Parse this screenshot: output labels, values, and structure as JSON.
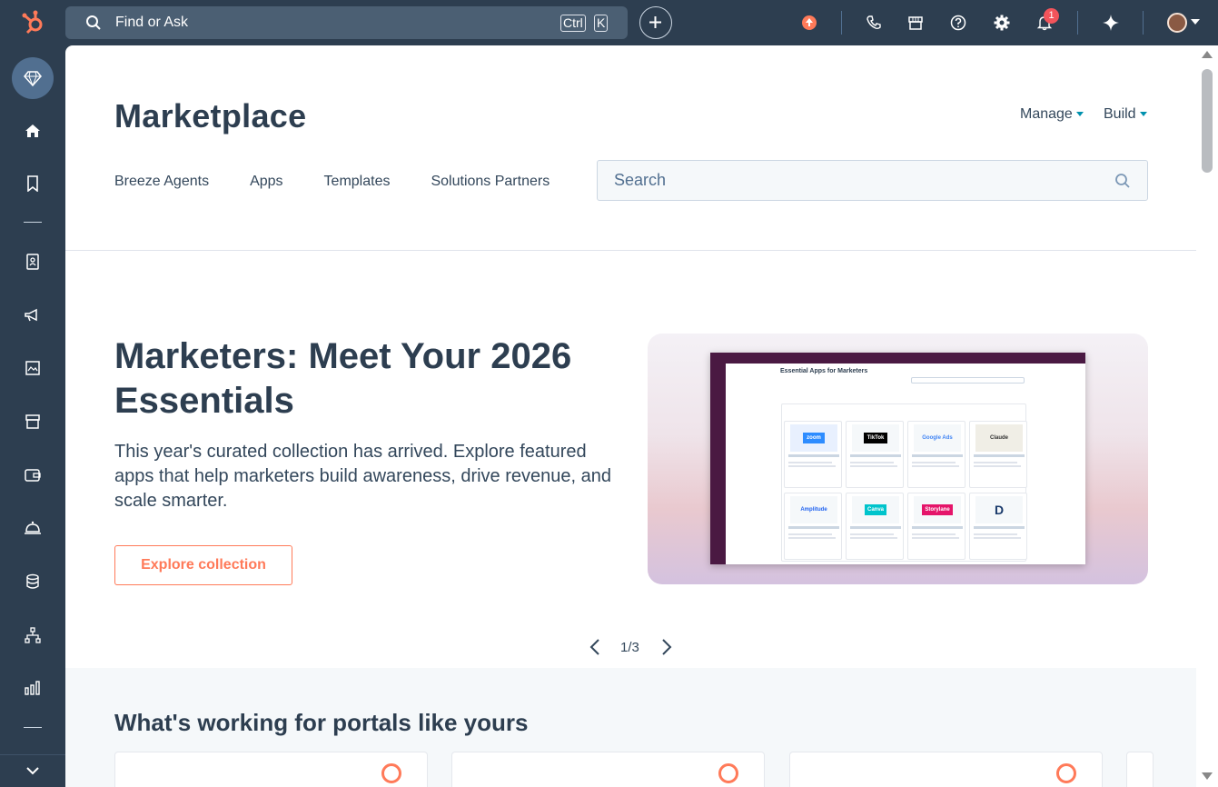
{
  "topbar": {
    "search_label": "Find or Ask",
    "kbd_ctrl": "Ctrl",
    "kbd_k": "K",
    "notifications_count": "1",
    "icons": [
      "upgrade-icon",
      "phone-icon",
      "marketplace-icon",
      "help-icon",
      "settings-icon",
      "bell-icon",
      "sparkle-icon"
    ]
  },
  "sidebar": {
    "items": [
      "gem-icon",
      "home-icon",
      "bookmark-icon",
      "contacts-icon",
      "marketing-icon",
      "content-icon",
      "commerce-icon",
      "sales-icon",
      "service-icon",
      "data-icon",
      "automation-icon",
      "reporting-icon"
    ]
  },
  "header": {
    "title": "Marketplace",
    "manage": "Manage",
    "build": "Build"
  },
  "tabs": [
    "Breeze Agents",
    "Apps",
    "Templates",
    "Solutions Partners"
  ],
  "search": {
    "placeholder": "Search"
  },
  "hero": {
    "title": "Marketers: Meet Your 2026 Essentials",
    "description": "This year's curated collection has arrived. Explore featured apps that help marketers build awareness, drive revenue, and scale smarter.",
    "button": "Explore collection",
    "screenshot_title": "Essential Apps for Marketers",
    "screenshot_apps": [
      "zoom",
      "TikTok",
      "Google Ads",
      "Claude",
      "Amplitude",
      "Canva",
      "Storylane",
      "D"
    ]
  },
  "pager": {
    "text": "1/3"
  },
  "section": {
    "title": "What's working for portals like yours"
  },
  "colors": {
    "accent": "#ff7a59",
    "nav": "#2d3e50",
    "text": "#33475b"
  }
}
